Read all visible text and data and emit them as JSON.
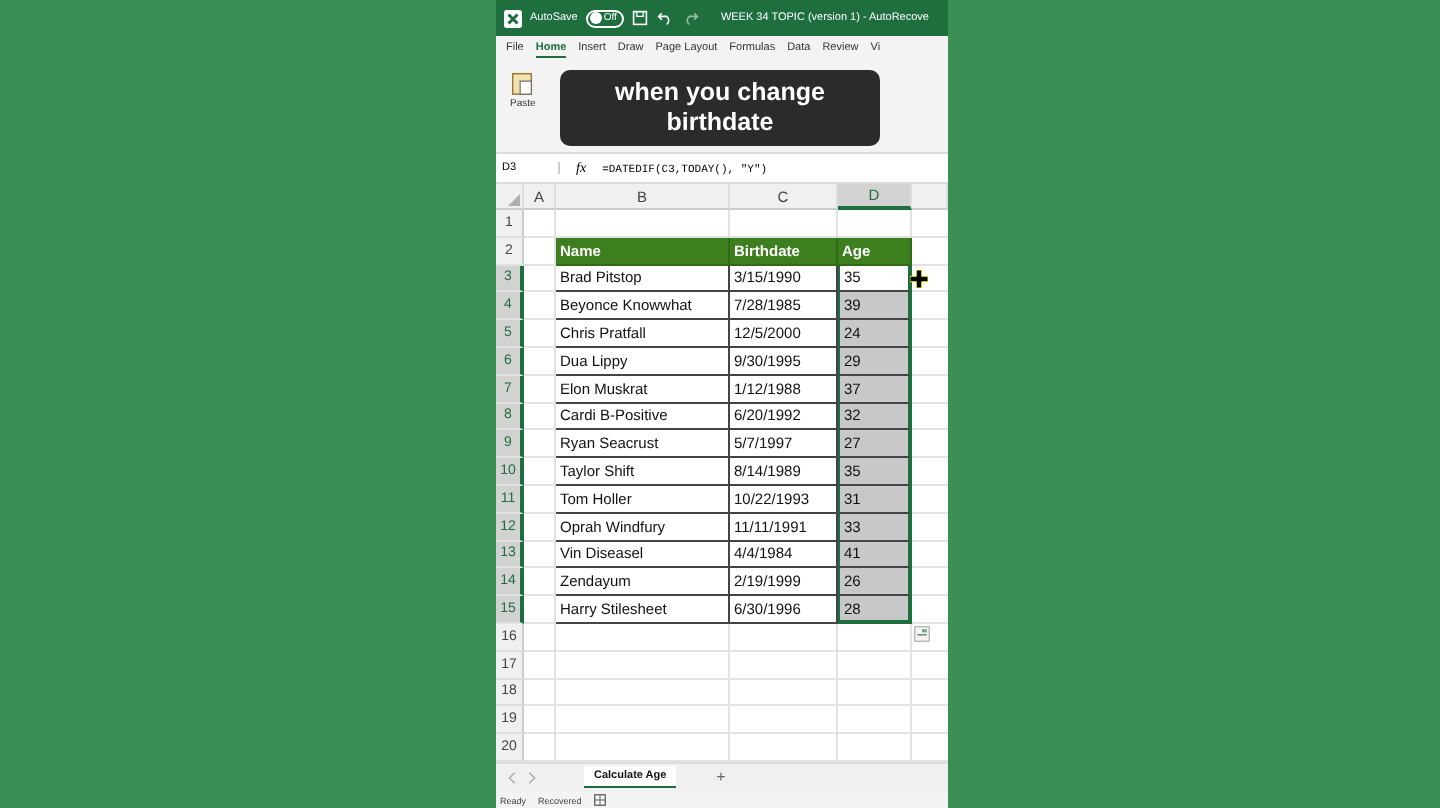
{
  "title_bar": {
    "autosave_label": "AutoSave",
    "autosave_toggle": {
      "on": false,
      "label": "Off"
    },
    "document_title": "WEEK 34 TOPIC (version 1)  -  AutoRecove"
  },
  "menu_tabs": [
    {
      "label": "File",
      "selected": false
    },
    {
      "label": "Home",
      "selected": true
    },
    {
      "label": "Insert",
      "selected": false
    },
    {
      "label": "Draw",
      "selected": false
    },
    {
      "label": "Page Layout",
      "selected": false
    },
    {
      "label": "Formulas",
      "selected": false
    },
    {
      "label": "Data",
      "selected": false
    },
    {
      "label": "Review",
      "selected": false
    },
    {
      "label": "Vi",
      "selected": false
    }
  ],
  "ribbon": {
    "paste_label": "Paste"
  },
  "caption": "when you change birthdate",
  "formula_bar": {
    "name_box": "D3",
    "fx": "fx",
    "formula": "=DATEDIF(C3,TODAY(), \"Y\")"
  },
  "columns": [
    {
      "label": "A",
      "selected": false
    },
    {
      "label": "B",
      "selected": false
    },
    {
      "label": "C",
      "selected": false
    },
    {
      "label": "D",
      "selected": true
    }
  ],
  "table_header": [
    "Name",
    "Birthdate",
    "Age"
  ],
  "rows": [
    {
      "name": "Brad Pitstop",
      "birthdate": "3/15/1990",
      "age": "35",
      "selected": true,
      "active": true
    },
    {
      "name": "Beyonce Knowwhat",
      "birthdate": "7/28/1985",
      "age": "39",
      "selected": true,
      "active": false
    },
    {
      "name": "Chris Pratfall",
      "birthdate": "12/5/2000",
      "age": "24",
      "selected": true,
      "active": false
    },
    {
      "name": "Dua Lippy",
      "birthdate": "9/30/1995",
      "age": "29",
      "selected": true,
      "active": false
    },
    {
      "name": "Elon Muskrat",
      "birthdate": "1/12/1988",
      "age": "37",
      "selected": true,
      "active": false
    },
    {
      "name": "Cardi B-Positive",
      "birthdate": "6/20/1992",
      "age": "32",
      "selected": true,
      "active": false
    },
    {
      "name": "Ryan Seacrust",
      "birthdate": "5/7/1997",
      "age": "27",
      "selected": true,
      "active": false
    },
    {
      "name": "Taylor Shift",
      "birthdate": "8/14/1989",
      "age": "35",
      "selected": true,
      "active": false
    },
    {
      "name": "Tom Holler",
      "birthdate": "10/22/1993",
      "age": "31",
      "selected": true,
      "active": false
    },
    {
      "name": "Oprah Windfury",
      "birthdate": "11/11/1991",
      "age": "33",
      "selected": true,
      "active": false
    },
    {
      "name": "Vin Diseasel",
      "birthdate": "4/4/1984",
      "age": "41",
      "selected": true,
      "active": false
    },
    {
      "name": "Zendayum",
      "birthdate": "2/19/1999",
      "age": "26",
      "selected": true,
      "active": false
    },
    {
      "name": "Harry Stilesheet",
      "birthdate": "6/30/1996",
      "age": "28",
      "selected": true,
      "active": false
    }
  ],
  "row_numbers": [
    "1",
    "2",
    "3",
    "4",
    "5",
    "6",
    "7",
    "8",
    "9",
    "10",
    "11",
    "12",
    "13",
    "14",
    "15",
    "16",
    "17",
    "18",
    "19",
    "20"
  ],
  "sheet_tabs": [
    {
      "label": "Calculate Age",
      "selected": true
    }
  ],
  "add_sheet": "+",
  "status_bar": [
    "Ready",
    "Recovered"
  ]
}
